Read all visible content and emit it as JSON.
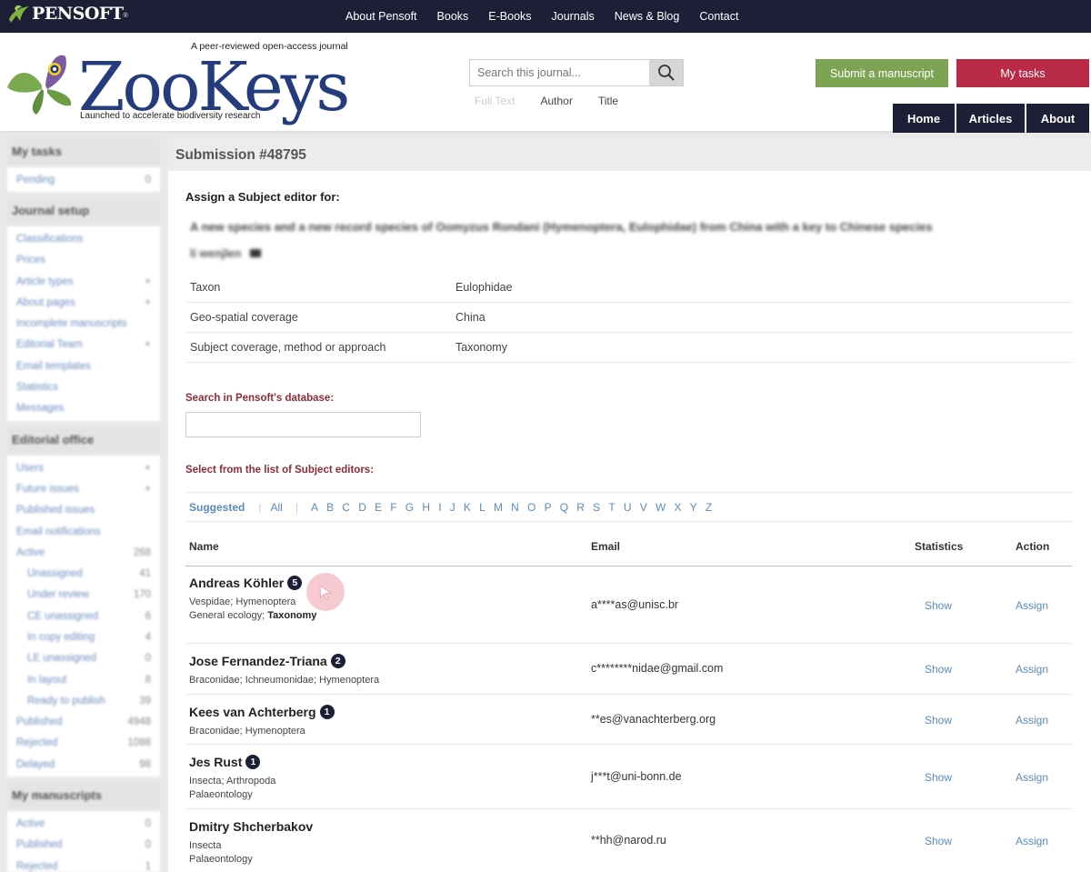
{
  "topbar": {
    "brand": "PENSOFT",
    "brand_reg": "®",
    "nav": [
      "About Pensoft",
      "Books",
      "E-Books",
      "Journals",
      "News & Blog",
      "Contact"
    ]
  },
  "header": {
    "tagline": "A peer-reviewed open-access journal",
    "logo_text": "ZooKeys",
    "logo_sub": "Launched to accelerate biodiversity research",
    "search_placeholder": "Search this journal...",
    "search_options": [
      "Full Text",
      "Author",
      "Title"
    ],
    "submit_label": "Submit a manuscript",
    "mytasks_label": "My tasks",
    "main_nav": [
      "Home",
      "Articles",
      "About"
    ]
  },
  "sidebar": {
    "sections": [
      {
        "title": "My tasks",
        "items": [
          {
            "label": "Pending",
            "count": "0"
          }
        ]
      },
      {
        "title": "Journal setup",
        "items": [
          {
            "label": "Classifications",
            "count": ""
          },
          {
            "label": "Prices",
            "count": ""
          },
          {
            "label": "Article types",
            "count": "+"
          },
          {
            "label": "About pages",
            "count": "+"
          },
          {
            "label": "Incomplete manuscripts",
            "count": ""
          },
          {
            "label": "Editorial Team",
            "count": "+"
          },
          {
            "label": "Email templates",
            "count": ""
          },
          {
            "label": "Statistics",
            "count": ""
          },
          {
            "label": "Messages",
            "count": ""
          }
        ]
      },
      {
        "title": "Editorial office",
        "items": [
          {
            "label": "Users",
            "count": "+"
          },
          {
            "label": "Future issues",
            "count": "+"
          },
          {
            "label": "Published issues",
            "count": ""
          },
          {
            "label": "Email notifications",
            "count": ""
          },
          {
            "label": "Active",
            "count": "268"
          },
          {
            "label": "Unassigned",
            "count": "41",
            "sub": true
          },
          {
            "label": "Under review",
            "count": "170",
            "sub": true
          },
          {
            "label": "CE unassigned",
            "count": "6",
            "sub": true
          },
          {
            "label": "In copy editing",
            "count": "4",
            "sub": true
          },
          {
            "label": "LE unassigned",
            "count": "0",
            "sub": true
          },
          {
            "label": "In layout",
            "count": "8",
            "sub": true
          },
          {
            "label": "Ready to publish",
            "count": "39",
            "sub": true
          },
          {
            "label": "Published",
            "count": "4948"
          },
          {
            "label": "Rejected",
            "count": "1088"
          },
          {
            "label": "Delayed",
            "count": "98"
          }
        ]
      },
      {
        "title": "My manuscripts",
        "items": [
          {
            "label": "Active",
            "count": "0"
          },
          {
            "label": "Published",
            "count": "0"
          },
          {
            "label": "Rejected",
            "count": "1"
          }
        ]
      }
    ]
  },
  "main": {
    "heading": "Submission #48795",
    "assign_title": "Assign a Subject editor for:",
    "manuscript_title": "A new species and a new record species of Oomyzus Rondani (Hymenoptera, Eulophidae) from China with a key to Chinese species",
    "manuscript_author": "li wenjlen",
    "meta": [
      {
        "key": "Taxon",
        "value": "Eulophidae"
      },
      {
        "key": "Geo-spatial coverage",
        "value": "China"
      },
      {
        "key": "Subject coverage, method or approach",
        "value": "Taxonomy"
      }
    ],
    "search_db_label": "Search in Pensoft's database:",
    "select_label": "Select from the list of Subject editors:",
    "alpha": {
      "suggested": "Suggested",
      "all": "All",
      "letters": [
        "A",
        "B",
        "C",
        "D",
        "E",
        "F",
        "G",
        "H",
        "I",
        "J",
        "K",
        "L",
        "M",
        "N",
        "O",
        "P",
        "Q",
        "R",
        "S",
        "T",
        "U",
        "V",
        "W",
        "X",
        "Y",
        "Z"
      ]
    },
    "table_headers": {
      "name": "Name",
      "email": "Email",
      "statistics": "Statistics",
      "action": "Action"
    },
    "editors": [
      {
        "name": "Andreas Köhler",
        "badge": "5",
        "line1": "Vespidae; Hymenoptera",
        "line2a": "General ecology; ",
        "line2b": "Taxonomy",
        "email": "a****as@unisc.br",
        "show": "Show",
        "assign": "Assign"
      },
      {
        "name": "Jose Fernandez-Triana",
        "badge": "2",
        "line1": "Braconidae; Ichneumonidae; Hymenoptera",
        "line2a": "",
        "line2b": "",
        "email": "c********nidae@gmail.com",
        "show": "Show",
        "assign": "Assign"
      },
      {
        "name": "Kees van Achterberg",
        "badge": "1",
        "line1": "Braconidae; Hymenoptera",
        "line2a": "",
        "line2b": "",
        "email": "**es@vanachterberg.org",
        "show": "Show",
        "assign": "Assign"
      },
      {
        "name": "Jes Rust",
        "badge": "1",
        "line1": "Insecta; Arthropoda",
        "line2a": "Palaeontology",
        "line2b": "",
        "email": "j***t@uni-bonn.de",
        "show": "Show",
        "assign": "Assign"
      },
      {
        "name": "Dmitry Shcherbakov",
        "badge": "",
        "line1": "Insecta",
        "line2a": "Palaeontology",
        "line2b": "",
        "email": "**hh@narod.ru",
        "show": "Show",
        "assign": "Assign"
      }
    ]
  }
}
